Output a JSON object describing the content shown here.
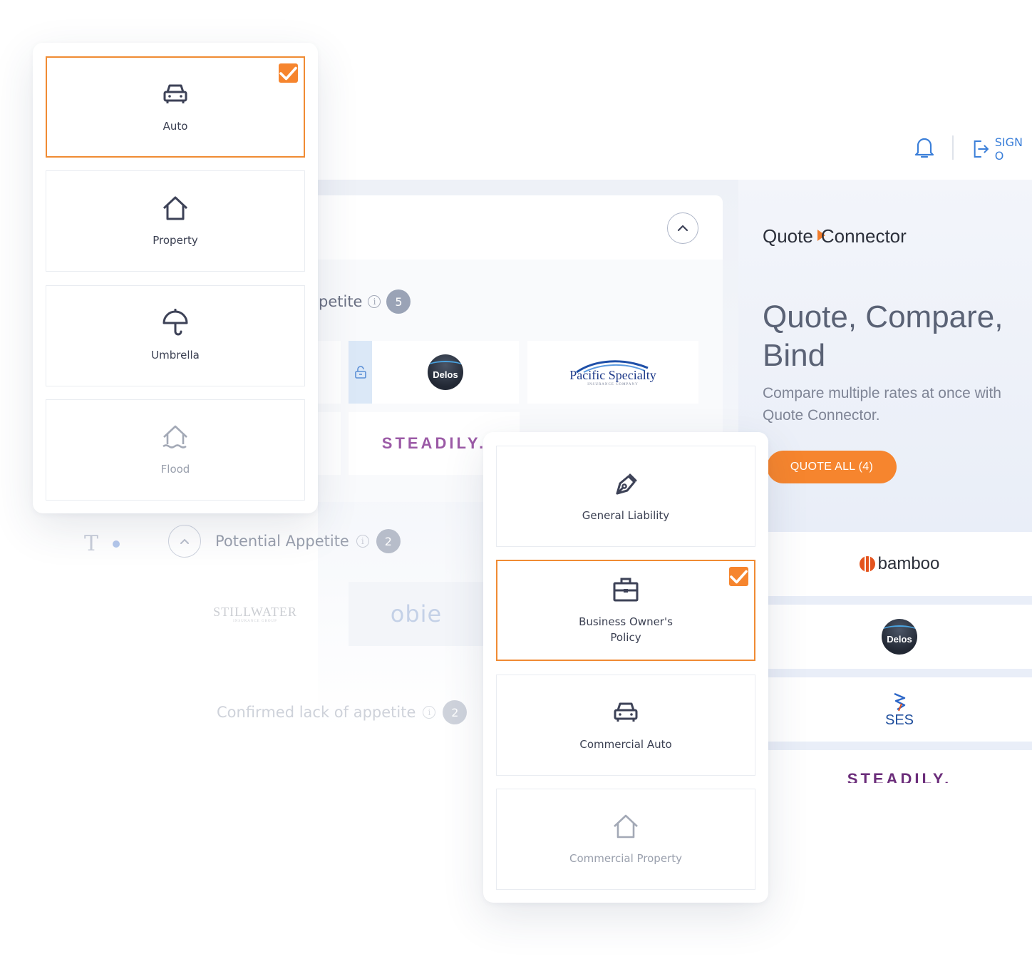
{
  "header": {
    "sign_out_label": "SIGN O"
  },
  "appetite": {
    "title": "petite",
    "count": "5",
    "carriers": {
      "delos": "Delos",
      "pacific": "Pacific Specialty",
      "pacific_sub": "INSURANCE COMPANY",
      "steadily": "STEADILY."
    }
  },
  "potential": {
    "title": "Potential Appetite",
    "count": "2",
    "carriers": {
      "stillwater": "STILLWATER",
      "stillwater_sub": "INSURANCE GROUP",
      "obie": "obie"
    }
  },
  "confirmed": {
    "title": "Confirmed lack of appetite",
    "count": "2"
  },
  "quote_connector": {
    "brand_left": "Quote",
    "brand_right": "Connector",
    "headline": "Quote, Compare, Bind",
    "subtext": "Compare multiple rates at once with Quote Connector.",
    "button_label": "QUOTE ALL (4)",
    "carriers": {
      "bamboo": "bamboo",
      "delos": "Delos",
      "ses": "SES",
      "steadily": "STEADILY."
    }
  },
  "personal_lines": {
    "tiles": [
      {
        "label": "Auto",
        "icon": "car-icon",
        "selected": true
      },
      {
        "label": "Property",
        "icon": "house-icon",
        "selected": false
      },
      {
        "label": "Umbrella",
        "icon": "umbrella-icon",
        "selected": false
      },
      {
        "label": "Flood",
        "icon": "flood-house-icon",
        "selected": false,
        "muted": true
      }
    ]
  },
  "commercial_lines": {
    "tiles": [
      {
        "label": "General Liability",
        "icon": "pen-nib-icon",
        "selected": false
      },
      {
        "label": "Business Owner's Policy",
        "icon": "briefcase-icon",
        "selected": true
      },
      {
        "label": "Commercial Auto",
        "icon": "car-icon",
        "selected": false
      },
      {
        "label": "Commercial Property",
        "icon": "house-icon",
        "selected": false,
        "muted": true
      }
    ]
  },
  "colors": {
    "accent": "#f6852e",
    "link": "#3b7fd9",
    "text": "#3d4257"
  }
}
